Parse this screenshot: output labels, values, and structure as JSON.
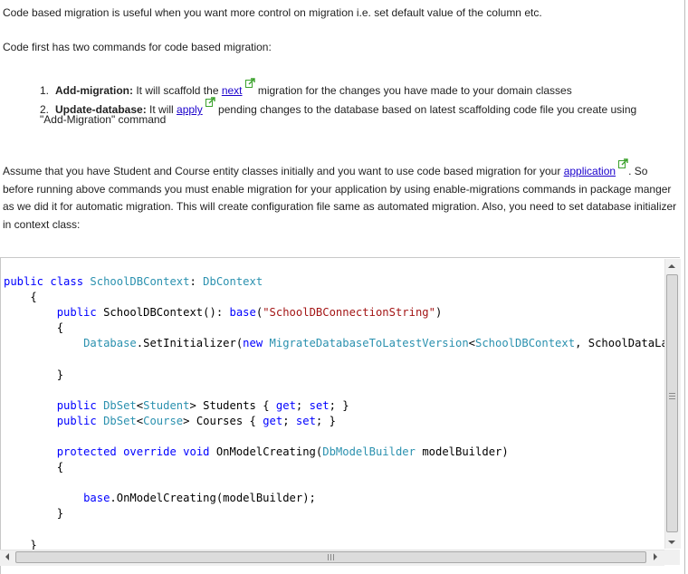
{
  "intro": {
    "line1": "Code based migration is useful when you want more control on migration i.e. set default value of the column etc.",
    "line2": "Code first has two commands for code based migration:"
  },
  "commands": [
    {
      "number": "1.",
      "name": "Add-migration:",
      "before": " It will scaffold the ",
      "link": "next",
      "after": " migration for the changes you have made to your domain classes"
    },
    {
      "number": "2.",
      "name": "Update-database:",
      "before": " It will ",
      "link": "apply",
      "after": " pending changes to the database based on latest scaffolding code file you create using",
      "continuation": "\"Add-Migration\" command"
    }
  ],
  "paragraph": {
    "before": "Assume that you have Student and Course entity classes initially and you want to use code based migration for your ",
    "link": "application",
    "after": ". So before running above commands you must enable migration for your application by using enable-migrations commands in package manger as we did it for automatic migration. This will create configuration file same as automated migration. Also, you need to set database initializer in context class:"
  },
  "code": {
    "kw_public": "public",
    "kw_class": "class",
    "kw_new": "new",
    "kw_get": "get",
    "kw_set": "set",
    "kw_protected": "protected",
    "kw_override": "override",
    "kw_void": "void",
    "kw_base": "base",
    "t_schooldbcontext": "SchoolDBContext",
    "t_dbcontext": "DbContext",
    "t_database": "Database",
    "t_migrate": "MigrateDatabaseToLatestVersion",
    "t_dbset": "DbSet",
    "t_student": "Student",
    "t_course": "Course",
    "t_modelbuilder": "DbModelBuilder",
    "s_connection": "\"SchoolDBConnectionString\"",
    "ctor_name": "SchoolDBContext",
    "set_initializer": ".SetInitializer(",
    "after_schooldbcontext": ", SchoolDataLa",
    "students_prop": " Students { ",
    "courses_prop": " Courses { ",
    "on_model_creating": " OnModelCreating(",
    "model_builder_param": " modelBuilder)",
    "base_call": ".OnModelCreating(modelBuilder);"
  },
  "colors": {
    "link": "#1a00cc",
    "keyword": "#0000ff",
    "type": "#2b91af",
    "string": "#a31515",
    "external_icon": "#3aa12b"
  }
}
